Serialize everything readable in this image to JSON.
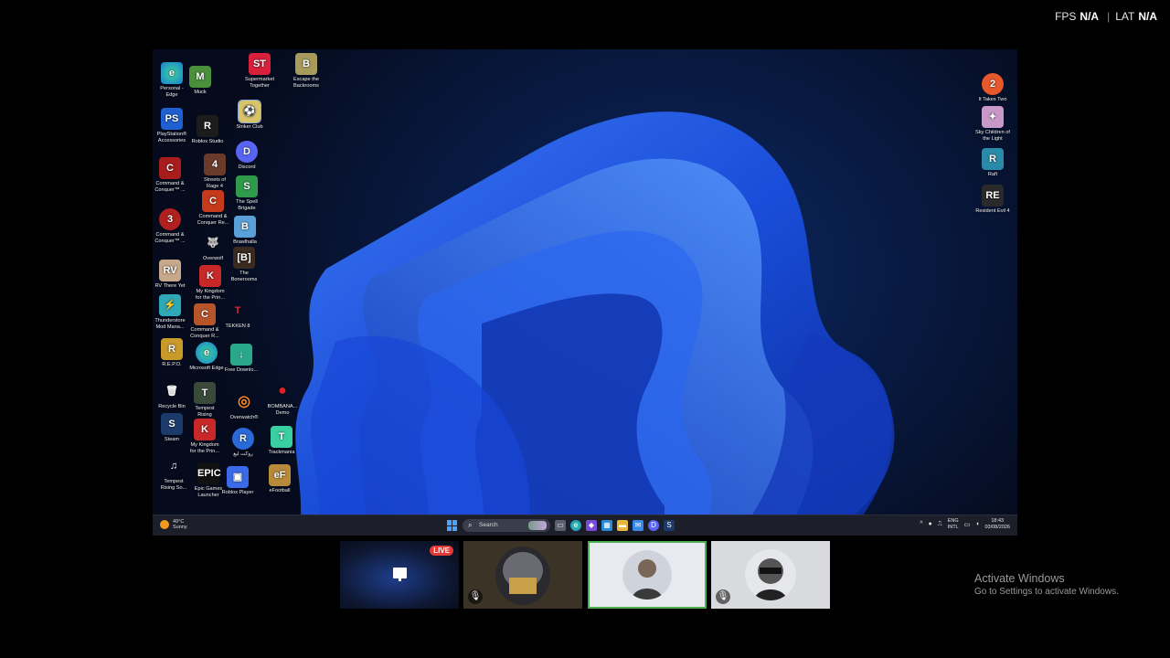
{
  "stats": {
    "fps_label": "FPS",
    "fps_value": "N/A",
    "lat_label": "LAT",
    "lat_value": "N/A"
  },
  "desktop_icons": {
    "personal_edge": "Personal - Edge",
    "muck": "Muck",
    "supermarket": "Supermarket Together",
    "escape": "Escape the Backrooms",
    "ps_accessories": "PlayStation® Accessories",
    "roblox_studio": "Roblox Studio",
    "striker_club": "Striker Club",
    "discord": "Discord",
    "cnc1": "Command & Conquer™ ...",
    "sor4": "Streets of Rage 4",
    "spell_brigade": "The Spell Brigade",
    "cnc2": "Command & Conquer™ ...",
    "cnc_re": "Command & Conquer Re...",
    "brawlhalla": "Brawlhalla",
    "overwolf": "Overwolf",
    "bonerooms": "The Bonerooms",
    "rv_there_yet": "RV There Yet",
    "mykingdom1": "My Kingdom for the Prin...",
    "thunderstore": "Thunderstore Mod Mana...",
    "cnc_r": "Command & Conquer R...",
    "tekken": "TEKKEN 8",
    "repo": "R.E.P.O.",
    "ms_edge": "Microsoft Edge",
    "free_download": "Free Downlo...",
    "recycle": "Recycle Bin",
    "tempest1": "Tempest Rising",
    "overwatch": "Overwatch®",
    "bombana": "BOMBANA... Demo",
    "steam": "Steam",
    "mykingdom2": "My Kingdom for the Prin...",
    "rocket": "روكت ليغ",
    "trackmania": "Trackmania",
    "tempest2": "Tempest Rising So...",
    "epic": "Epic Games Launcher",
    "roblox_player": "Roblox Player",
    "efootball": "eFootball",
    "it_takes_two": "It Takes Two",
    "sky": "Sky Children of the Light",
    "raft": "Raft",
    "re4": "Resident Evil 4"
  },
  "taskbar": {
    "weather_temp": "49°C",
    "weather_cond": "Sunny",
    "search_placeholder": "Search",
    "lang1": "ENG",
    "lang2": "INTL",
    "time": "18:43",
    "date": "03/08/2026"
  },
  "participants": {
    "live_badge": "LIVE"
  },
  "watermark": {
    "title": "Activate Windows",
    "subtitle": "Go to Settings to activate Windows."
  },
  "colors": {
    "accent_green": "#4caf50",
    "live_red": "#e53935",
    "taskbar": "#1c1f2a"
  }
}
